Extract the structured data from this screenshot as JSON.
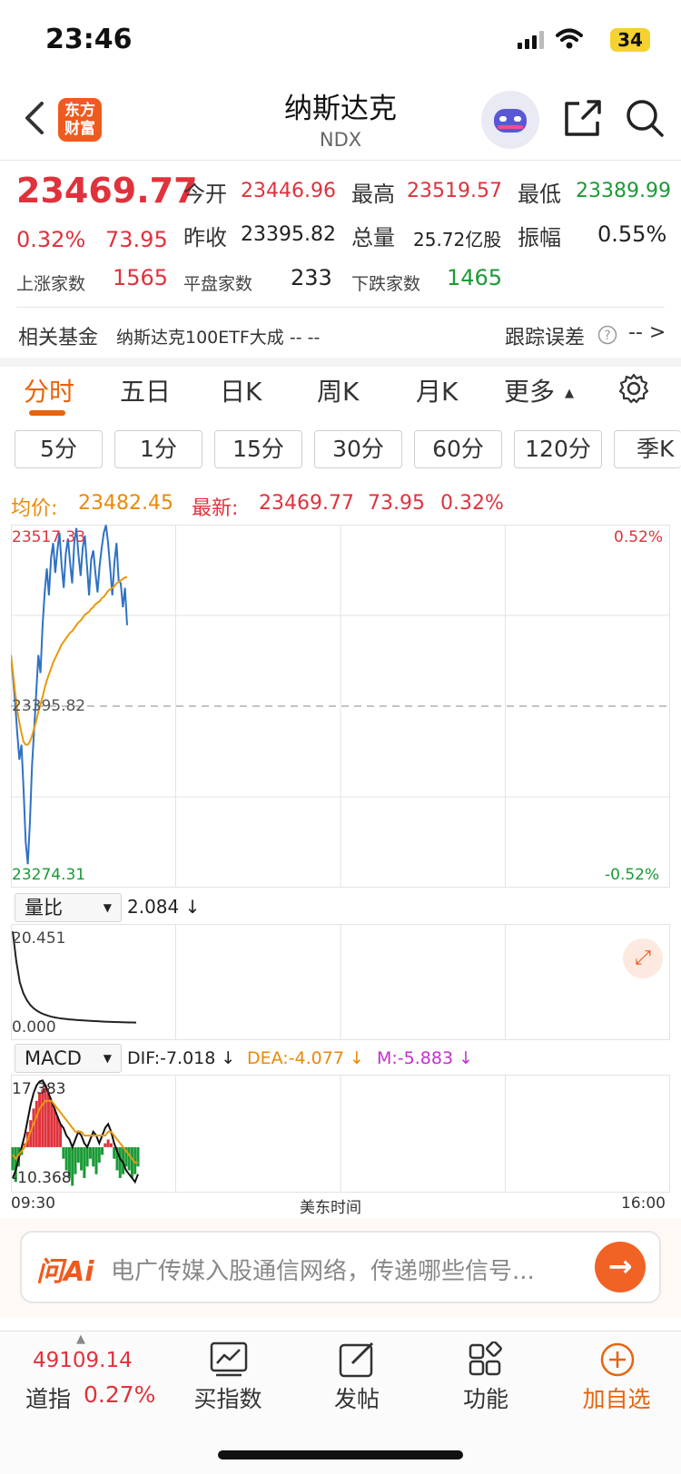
{
  "status_bar": {
    "time": "23:46",
    "battery": "34"
  },
  "header": {
    "title": "纳斯达克",
    "subtitle": "NDX",
    "logo_line1": "东方",
    "logo_line2": "财富"
  },
  "quote": {
    "price": "23469.77",
    "change_pct": "0.32%",
    "change": "73.95",
    "open_label": "今开",
    "open": "23446.96",
    "high_label": "最高",
    "high": "23519.57",
    "low_label": "最低",
    "low": "23389.99",
    "prev_close_label": "昨收",
    "prev_close": "23395.82",
    "volume_label": "总量",
    "volume": "25.72亿股",
    "amplitude_label": "振幅",
    "amplitude": "0.55%",
    "up_label": "上涨家数",
    "up": "1565",
    "flat_label": "平盘家数",
    "flat": "233",
    "down_label": "下跌家数",
    "down": "1465"
  },
  "fund": {
    "label": "相关基金",
    "name": "纳斯达克100ETF大成 -- --",
    "tracking_label": "跟踪误差",
    "tracking_value": "-- >"
  },
  "tabs": [
    "分时",
    "五日",
    "日K",
    "周K",
    "月K",
    "更多"
  ],
  "intervals": [
    "5分",
    "1分",
    "15分",
    "30分",
    "60分",
    "120分",
    "季K"
  ],
  "info_line": {
    "avg_label": "均价:",
    "avg": "23482.45",
    "latest_label": "最新:",
    "latest": "23469.77",
    "latest_change": "73.95",
    "latest_pct": "0.32%"
  },
  "colors": {
    "up": "#e0323c",
    "down": "#1a9a36",
    "price_line": "#2f72c4",
    "avg_line": "#e8990c",
    "accent": "#e8630c"
  },
  "chart_data": [
    {
      "type": "line",
      "name": "intraday",
      "ylim": [
        23274.31,
        23517.33
      ],
      "y_top_label": "23517.33",
      "y_mid_label": "23395.82",
      "y_bottom_label": "23274.31",
      "pct_top": "0.52%",
      "pct_bottom": "-0.52%",
      "x_start": "09:30",
      "x_end": "16:00",
      "x_label": "美东时间",
      "total_minutes": 390,
      "series": [
        {
          "values": [
            23430,
            23415,
            23398,
            23378,
            23360,
            23370,
            23340,
            23305,
            23290,
            23318,
            23356,
            23380,
            23405,
            23430,
            23418,
            23450,
            23472,
            23488,
            23470,
            23495,
            23505,
            23485,
            23500,
            23512,
            23490,
            23475,
            23498,
            23508,
            23492,
            23478,
            23505,
            23515,
            23497,
            23483,
            23502,
            23510,
            23490,
            23470,
            23494,
            23500,
            23485,
            23472,
            23490,
            23502,
            23512,
            23517,
            23505,
            23488,
            23470,
            23492,
            23505,
            23480,
            23478,
            23462,
            23475,
            23450
          ]
        },
        {
          "values": [
            23430,
            23418,
            23405,
            23393,
            23385,
            23378,
            23372,
            23370,
            23370,
            23372,
            23376,
            23381,
            23386,
            23392,
            23397,
            23402,
            23408,
            23413,
            23417,
            23421,
            23425,
            23428,
            23431,
            23434,
            23437,
            23439,
            23441,
            23443,
            23445,
            23446,
            23448,
            23450,
            23452,
            23453,
            23455,
            23457,
            23458,
            23459,
            23461,
            23462,
            23464,
            23465,
            23466,
            23468,
            23469,
            23471,
            23473,
            23474,
            23475,
            23476,
            23478,
            23479,
            23480,
            23481,
            23482,
            23482
          ]
        }
      ]
    },
    {
      "type": "line",
      "name": "volume_ratio",
      "dropdown": "量比",
      "current": "2.084 ↓",
      "y_top_label": "20.451",
      "y_bottom_label": "0.000",
      "ylim": [
        0,
        20.451
      ],
      "values": [
        20.4,
        14.5,
        10.2,
        8.0,
        6.6,
        5.6,
        4.9,
        4.4,
        4.0,
        3.7,
        3.45,
        3.25,
        3.1,
        2.98,
        2.88,
        2.8,
        2.72,
        2.66,
        2.6,
        2.55,
        2.5,
        2.46,
        2.42,
        2.38,
        2.34,
        2.3,
        2.27,
        2.24,
        2.21,
        2.18,
        2.16,
        2.14,
        2.12,
        2.1,
        2.09,
        2.084
      ]
    },
    {
      "type": "bar",
      "name": "macd",
      "dropdown": "MACD",
      "dif": "DIF:-7.018 ↓",
      "dea": "DEA:-4.077 ↓",
      "m": "M:-5.883 ↓",
      "y_top_label": "17.383",
      "y_bottom_label": "-10.368",
      "ylim": [
        -10.368,
        17.383
      ],
      "bars": [
        -6,
        -9,
        -5,
        -2,
        1,
        4,
        7,
        10,
        12,
        14,
        15,
        16,
        14,
        12,
        10,
        8,
        6,
        -3,
        -6,
        -8,
        -10,
        -7,
        -4,
        -6,
        -8,
        -5,
        -3,
        -5,
        -7,
        -4,
        -2,
        1,
        2,
        1,
        -3,
        -6,
        -8,
        -7,
        -5,
        -6,
        -8,
        -7,
        -5
      ],
      "dif_values": [
        -8,
        -6,
        -3,
        0,
        3,
        7,
        11,
        14,
        16,
        17,
        17.3,
        16,
        14,
        12,
        10,
        8,
        6,
        5,
        3,
        2,
        0,
        2,
        4,
        3,
        1,
        0,
        2,
        4,
        3,
        1,
        3,
        5,
        6,
        4,
        1,
        -1,
        -3,
        -4,
        -6,
        -7,
        -8,
        -9,
        -7
      ],
      "dea_values": [
        -2,
        -3,
        -2,
        -1,
        0,
        2,
        4,
        6,
        8,
        10,
        11,
        12,
        12,
        12,
        11,
        10,
        9,
        8,
        7,
        6,
        5,
        4,
        4,
        4,
        3,
        3,
        3,
        3,
        3,
        3,
        3,
        3,
        4,
        4,
        3,
        2,
        1,
        0,
        -1,
        -2,
        -3,
        -4,
        -4
      ]
    }
  ],
  "ask_bar": {
    "logo": "问Ai",
    "placeholder": "电广传媒入股通信网络，传递哪些信号..."
  },
  "bottom_bar": {
    "index_value": "49109.14",
    "index_name": "道指",
    "index_pct": "0.27%",
    "items": [
      "买指数",
      "发帖",
      "功能",
      "加自选"
    ]
  }
}
